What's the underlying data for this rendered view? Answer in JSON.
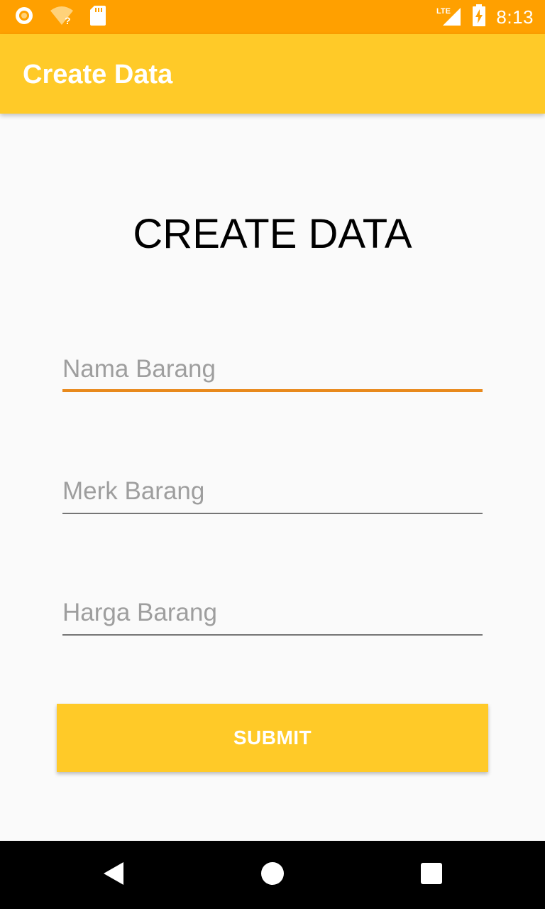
{
  "status_bar": {
    "time": "8:13",
    "network_label": "LTE",
    "icons": [
      "notification-dot-icon",
      "wifi-unknown-icon",
      "sd-card-icon",
      "lte-signal-icon",
      "battery-charging-icon"
    ]
  },
  "app_bar": {
    "title": "Create Data",
    "color": "#ffca28"
  },
  "main": {
    "heading": "CREATE DATA",
    "fields": [
      {
        "placeholder": "Nama Barang",
        "value": "",
        "focused": true
      },
      {
        "placeholder": "Merk Barang",
        "value": "",
        "focused": false
      },
      {
        "placeholder": "Harga Barang",
        "value": "",
        "focused": false
      }
    ],
    "submit_label": "SUBMIT"
  },
  "colors": {
    "status_bar": "#ffa000",
    "accent": "#e8891c",
    "background": "#fafafa"
  },
  "nav_bar": {
    "icons": [
      "back-icon",
      "home-icon",
      "recents-icon"
    ]
  }
}
